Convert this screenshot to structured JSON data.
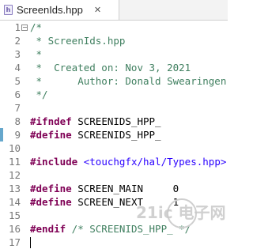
{
  "tab": {
    "icon_letter": "h",
    "title": "ScreenIds.hpp",
    "close": "✕"
  },
  "editor": {
    "lines": [
      {
        "num": "1",
        "fold": "⊖",
        "parts": [
          {
            "t": "/*",
            "c": "c"
          }
        ]
      },
      {
        "num": "2",
        "parts": [
          {
            "t": " * ScreenIds.hpp",
            "c": "c"
          }
        ]
      },
      {
        "num": "3",
        "parts": [
          {
            "t": " *",
            "c": "c"
          }
        ]
      },
      {
        "num": "4",
        "parts": [
          {
            "t": " *  Created on: Nov 3, 2021",
            "c": "c"
          }
        ]
      },
      {
        "num": "5",
        "parts": [
          {
            "t": " *      Author: Donald Swearingen",
            "c": "c"
          }
        ]
      },
      {
        "num": "6",
        "parts": [
          {
            "t": " */",
            "c": "c"
          }
        ]
      },
      {
        "num": "7",
        "parts": []
      },
      {
        "num": "8",
        "parts": [
          {
            "t": "#ifndef",
            "c": "kw"
          },
          {
            "t": " SCREENIDS_HPP_",
            "c": "pl"
          }
        ]
      },
      {
        "num": "9",
        "parts": [
          {
            "t": "#define",
            "c": "kw"
          },
          {
            "t": " SCREENIDS_HPP_",
            "c": "pl"
          }
        ]
      },
      {
        "num": "10",
        "parts": []
      },
      {
        "num": "11",
        "parts": [
          {
            "t": "#include",
            "c": "kw"
          },
          {
            "t": " ",
            "c": "pl"
          },
          {
            "t": "<touchgfx/hal/Types.hpp>",
            "c": "inc"
          }
        ]
      },
      {
        "num": "12",
        "parts": []
      },
      {
        "num": "13",
        "parts": [
          {
            "t": "#define",
            "c": "kw"
          },
          {
            "t": " SCREEN_MAIN     0",
            "c": "pl"
          }
        ]
      },
      {
        "num": "14",
        "parts": [
          {
            "t": "#define",
            "c": "kw"
          },
          {
            "t": " SCREEN_NEXT     1",
            "c": "pl"
          }
        ]
      },
      {
        "num": "15",
        "parts": []
      },
      {
        "num": "16",
        "parts": [
          {
            "t": "#endif",
            "c": "kw"
          },
          {
            "t": " /* SCREENIDS_HPP_ */",
            "c": "c"
          }
        ]
      },
      {
        "num": "17",
        "parts": []
      }
    ]
  },
  "watermark": {
    "text": "21ic 电子网",
    "color": "#c8c8c8"
  },
  "colors": {
    "marker": "#66a7cc",
    "comment": "#3f7f5f",
    "keyword": "#7f0055",
    "include": "#2a00ff"
  }
}
